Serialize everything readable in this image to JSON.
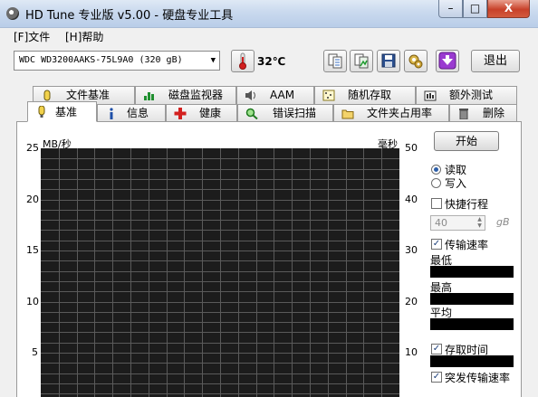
{
  "window": {
    "title": "HD Tune 专业版 v5.00 - 硬盘专业工具",
    "minimize_glyph": "–",
    "maximize_glyph": "□",
    "close_glyph": "X"
  },
  "menu": [
    {
      "label": "[F]文件"
    },
    {
      "label": "[H]帮助"
    }
  ],
  "toolbar": {
    "drive": "WDC WD3200AAKS-75L9A0 (320 gB)",
    "temperature": "32℃",
    "buttons": [
      {
        "icon": "copy-text-icon"
      },
      {
        "icon": "copy-image-icon"
      },
      {
        "icon": "save-icon"
      },
      {
        "icon": "options-icon"
      },
      {
        "icon": "download-icon"
      }
    ],
    "exit_label": "退出"
  },
  "tabs_row1": [
    {
      "label": "文件基准",
      "icon": "file-benchmark-icon"
    },
    {
      "label": "磁盘监视器",
      "icon": "disk-monitor-icon"
    },
    {
      "label": "AAM",
      "icon": "speaker-icon"
    },
    {
      "label": "随机存取",
      "icon": "random-access-icon"
    },
    {
      "label": "额外测试",
      "icon": "extra-tests-icon"
    }
  ],
  "tabs_row2": [
    {
      "label": "基准",
      "icon": "benchmark-icon",
      "active": true
    },
    {
      "label": "信息",
      "icon": "info-icon"
    },
    {
      "label": "健康",
      "icon": "health-icon"
    },
    {
      "label": "错误扫描",
      "icon": "error-scan-icon"
    },
    {
      "label": "文件夹占用率",
      "icon": "folder-usage-icon"
    },
    {
      "label": "删除",
      "icon": "erase-icon"
    }
  ],
  "chart_data": {
    "type": "line",
    "series": [],
    "ylabel": "MB/秒",
    "y2label": "毫秒",
    "ylim": [
      0,
      25
    ],
    "y2lim": [
      0,
      50
    ],
    "yticks": [
      "25",
      "20",
      "15",
      "10",
      "5"
    ],
    "y2ticks": [
      "50",
      "40",
      "30",
      "20",
      "10"
    ],
    "grid": true,
    "background": "#1c1c1c",
    "grid_color": "#5a5a5a"
  },
  "controls": {
    "start_label": "开始",
    "read_label": "读取",
    "write_label": "写入",
    "read_selected": true,
    "short_stroke_label": "快捷行程",
    "short_stroke_checked": false,
    "short_stroke_value": "40",
    "short_stroke_unit": "gB",
    "transfer_rate_label": "传输速率",
    "transfer_rate_checked": true,
    "min_label": "最低",
    "max_label": "最高",
    "avg_label": "平均",
    "access_time_label": "存取时间",
    "access_time_checked": true,
    "burst_rate_label": "突发传输速率",
    "burst_rate_checked": true
  }
}
